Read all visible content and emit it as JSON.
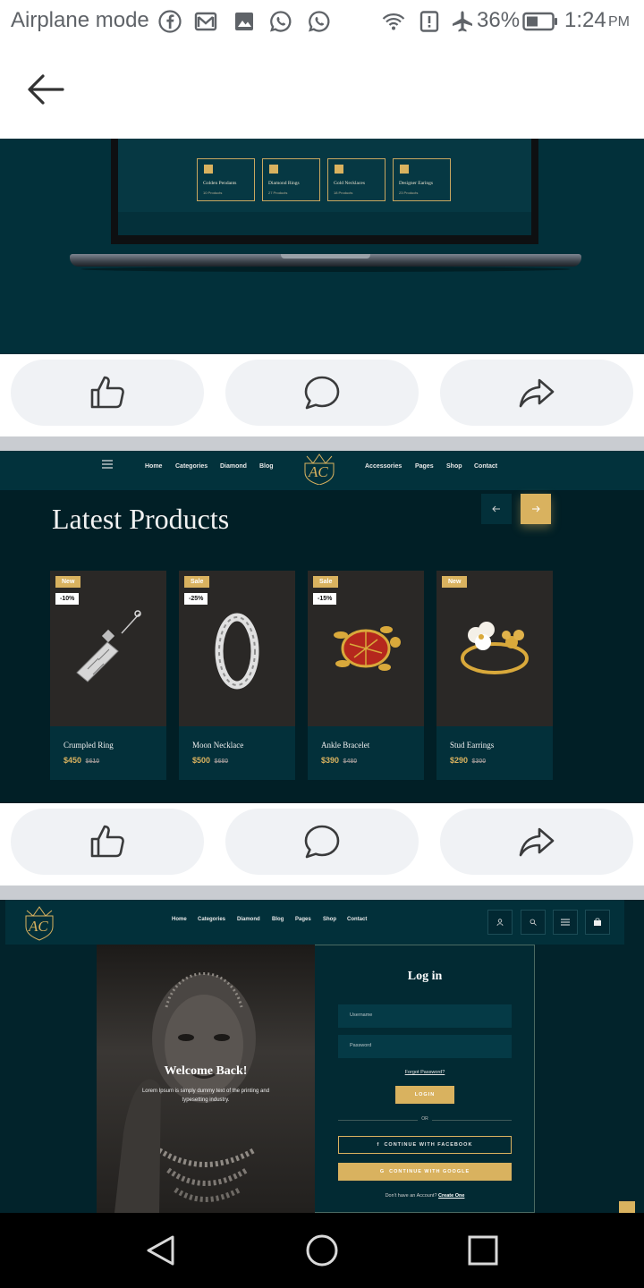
{
  "status_bar": {
    "airplane_label": "Airplane mode",
    "battery": "36%",
    "time": "1:24",
    "ampm": "PM"
  },
  "post1": {
    "categories": [
      {
        "name": "Golden Pendants",
        "count": "10 Products"
      },
      {
        "name": "Diamond Rings",
        "count": "27 Products"
      },
      {
        "name": "Gold Necklaces",
        "count": "18 Products"
      },
      {
        "name": "Designer Earings",
        "count": "23 Products"
      }
    ]
  },
  "post2": {
    "nav_left": [
      "Home",
      "Categories",
      "Diamond",
      "Blog"
    ],
    "nav_right": [
      "Accessories",
      "Pages",
      "Shop",
      "Contact"
    ],
    "logo": "AC",
    "heading": "Latest Products",
    "products": [
      {
        "name": "Crumpled Ring",
        "price": "$450",
        "old_price": "$610",
        "badge": "New",
        "discount": "-10%"
      },
      {
        "name": "Moon Necklace",
        "price": "$500",
        "old_price": "$680",
        "badge": "Sale",
        "discount": "-25%"
      },
      {
        "name": "Ankle Bracelet",
        "price": "$390",
        "old_price": "$480",
        "badge": "Sale",
        "discount": "-15%"
      },
      {
        "name": "Stud Earrings",
        "price": "$290",
        "old_price": "$300",
        "badge": "New",
        "discount": ""
      }
    ]
  },
  "post3": {
    "logo": "AC",
    "nav": [
      "Home",
      "Categories",
      "Diamond",
      "Blog",
      "Pages",
      "Shop",
      "Contact"
    ],
    "welcome_title": "Welcome Back!",
    "welcome_text_1": "Lorem Ipsum is simply dummy text of the printing and",
    "welcome_text_2": "typesetting industry.",
    "login_title": "Log in",
    "username_placeholder": "Username",
    "password_placeholder": "Password",
    "forgot": "Forgot Password?",
    "login_button": "LOGIN",
    "or": "OR",
    "facebook_button": "CONTINUE WITH FACEBOOK",
    "google_button": "CONTINUE WITH GOOGLE",
    "no_account": "Don't have an Account?",
    "create_one": "Create One"
  },
  "colors": {
    "teal": "#02303a",
    "dark": "#011f26",
    "gold": "#d9b25f",
    "pill": "#f0f2f5"
  },
  "icons": [
    "back-arrow-icon",
    "like-icon",
    "comment-icon",
    "share-icon",
    "facebook-icon",
    "gmail-icon",
    "gallery-icon",
    "whatsapp-icon",
    "wifi-icon",
    "alert-icon",
    "airplane-icon",
    "battery-icon",
    "back-nav-icon",
    "home-nav-icon",
    "recents-nav-icon"
  ]
}
